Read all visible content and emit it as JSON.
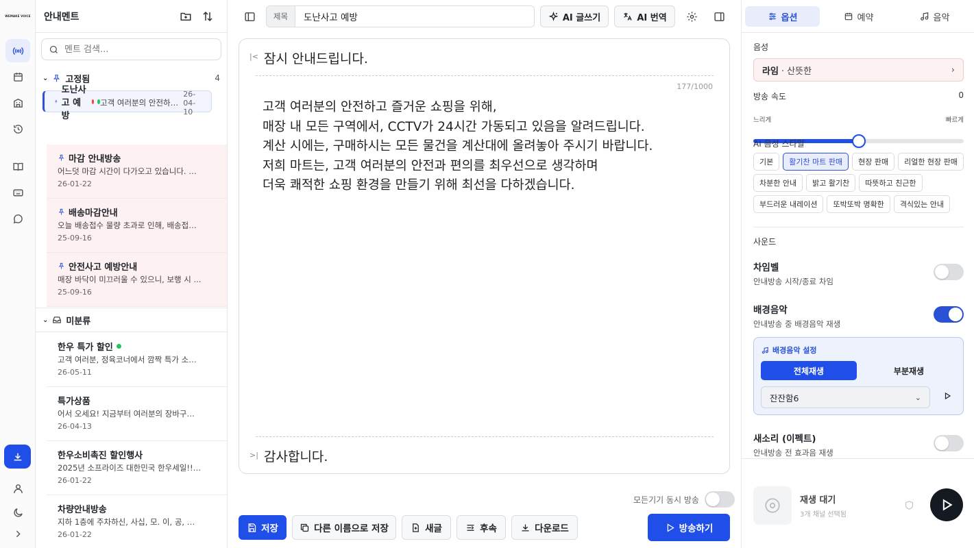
{
  "rail": {
    "logo": "WEMAKE VOICE"
  },
  "list": {
    "title": "안내멘트",
    "search_placeholder": "멘트 검색...",
    "pinned_label": "고정됨",
    "pinned_count": "4",
    "pinned": [
      {
        "title": "도난사고 예방",
        "preview": "고객 여러분의 안전하고 즐거운 쇼핑을 위...",
        "date": "26-04-10"
      },
      {
        "title": "마감 안내방송",
        "preview": "어느덧 마감 시간이 다가오고 있습니다. 저...",
        "date": "26-01-22"
      },
      {
        "title": "배송마감안내",
        "preview": "오늘 배송접수 물량 초과로 인해, 배송접수...",
        "date": "25-09-16"
      },
      {
        "title": "안전사고 예방안내",
        "preview": "매장 바닥이 미끄러울 수 있으니, 보행 시 ...",
        "date": "25-09-16"
      }
    ],
    "unsorted_label": "미분류",
    "unsorted": [
      {
        "title": "한우 특가 할인",
        "preview": "고객 여러분, 정육코너에서 깜짝 특가 소식...",
        "date": "26-05-11"
      },
      {
        "title": "특가상품",
        "preview": "어서 오세요! 지금부터 여러분의 장바구니...",
        "date": "26-04-13"
      },
      {
        "title": "한우소비촉진 할인행사",
        "preview": "2025년 소프라이즈 대한민국 한우세일!! ...",
        "date": "26-01-22"
      },
      {
        "title": "차량안내방송",
        "preview": "지하 1층에 주차하신, 사십, 모. 이, 공, 일, ...",
        "date": "26-01-22"
      }
    ]
  },
  "toolbar": {
    "title_label": "제목",
    "title_value": "도난사고 예방",
    "ai_write": "AI 글쓰기",
    "ai_translate": "AI 번역"
  },
  "editor": {
    "intro": "잠시 안내드립니다.",
    "counter": "177/1000",
    "lines": [
      "고객 여러분의 안전하고 즐거운 쇼핑을 위해,",
      "매장 내 모든 구역에서, CCTV가 24시간 가동되고 있음을 알려드립니다.",
      "계산 시에는, 구매하시는 모든 물건을 계산대에 올려놓아 주시기 바랍니다.",
      "저희 마트는, 고객 여러분의 안전과 편의를 최우선으로 생각하며",
      "더욱 쾌적한 쇼핑 환경을 만들기 위해 최선을 다하겠습니다."
    ],
    "outro": "감사합니다."
  },
  "footer": {
    "broadcast_all": "모든기기 동시 방송",
    "save": "저장",
    "save_as": "다른 이름으로 저장",
    "new": "새글",
    "postfix": "후속",
    "download": "다운로드",
    "broadcast": "방송하기"
  },
  "right": {
    "tabs": [
      "옵션",
      "예약",
      "음악"
    ],
    "voice_label": "음성",
    "voice_name": "라임",
    "voice_desc": "· 산뜻한",
    "speed_label": "방송 속도",
    "speed_value": "0",
    "speed_fraction": 0.5,
    "slow": "느리게",
    "fast": "빠르게",
    "style_label": "AI 음성 스타일",
    "styles": [
      "기본",
      "활기찬 마트 판매",
      "현장 판매",
      "리얼한 현장 판매",
      "차분한 안내",
      "밝고 활기찬",
      "따뜻하고 친근한",
      "부드러운 내레이션",
      "또박또박 명확한",
      "격식있는 안내"
    ],
    "selected_style": "활기찬 마트 판매",
    "sound_label": "사운드",
    "chime_title": "차임벨",
    "chime_desc": "안내방송 시작/종료 차임",
    "bgm_title": "배경음악",
    "bgm_desc": "안내방송 중 배경음악 재생",
    "bgm_settings": "배경음악 설정",
    "bgm_full": "전체재생",
    "bgm_partial": "부분재생",
    "bgm_track": "잔잔함6",
    "sfx_title": "새소리 (이펙트)",
    "sfx_desc": "안내방송 전 효과음 재생",
    "player_status": "재생 대기",
    "player_sub": "3개 채널 선택됨"
  },
  "colors": {
    "accent": "#1f4ee8",
    "pinned_bg": "#fdf1f1",
    "dot_red": "#ef4444",
    "dot_green": "#22c55e"
  }
}
